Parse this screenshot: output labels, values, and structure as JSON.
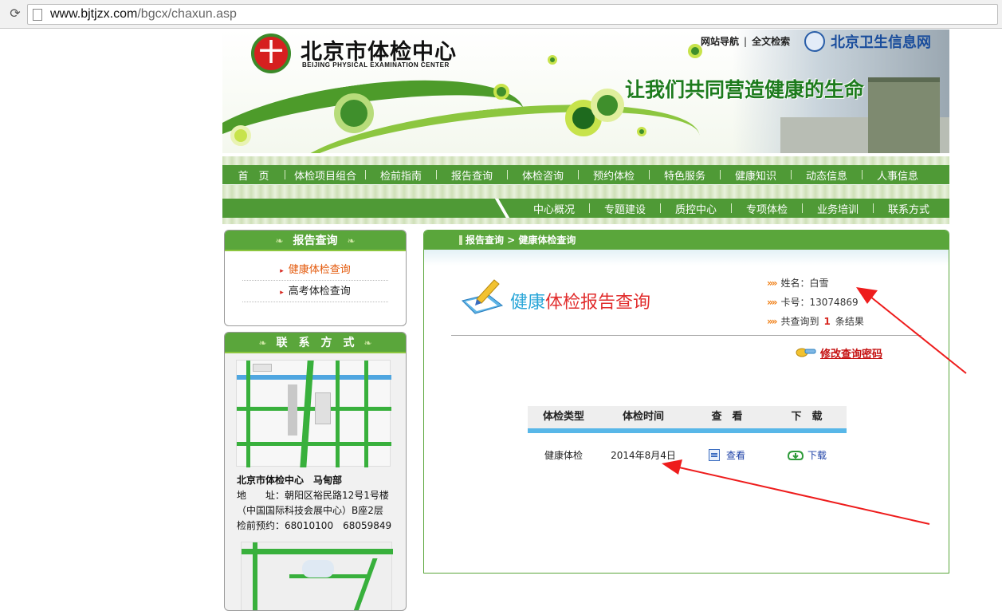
{
  "browser": {
    "url_host": "www.bjtjzx.com",
    "url_path": "/bgcx/chaxun.asp"
  },
  "header": {
    "title_cn": "北京市体检中心",
    "title_en": "BEIJING PHYSICAL EXAMINATION CENTER",
    "slogan": "让我们共同营造健康的生命",
    "link_nav": "网站导航",
    "link_search": "全文检索",
    "partner": "北京卫生信息网"
  },
  "nav_main": [
    "首　页",
    "体检项目组合",
    "检前指南",
    "报告查询",
    "体检咨询",
    "预约体检",
    "特色服务",
    "健康知识",
    "动态信息",
    "人事信息"
  ],
  "nav_sub": [
    "中心概况",
    "专题建设",
    "质控中心",
    "专项体检",
    "业务培训",
    "联系方式"
  ],
  "sidebar": {
    "report_title": "报告查询",
    "report_items": [
      "健康体检查询",
      "高考体检查询"
    ],
    "contact_title": "联　系　方　式",
    "contact_name": "北京市体检中心　马甸部",
    "contact_addr_1": "地　　址：朝阳区裕民路12号1号楼",
    "contact_addr_2": "（中国国际科技会展中心）B座2层",
    "contact_phone": "检前预约：68010100　68059849"
  },
  "content": {
    "breadcrumb": "报告查询 > 健康体检查询",
    "title_blue": "健康",
    "title_red": "体检报告查询",
    "name_label": "姓名：白雪",
    "card_label": "卡号：13074869",
    "result_prefix": "共查询到",
    "result_count": "1",
    "result_suffix": "条结果",
    "change_pwd": "修改查询密码"
  },
  "table": {
    "headers": [
      "体检类型",
      "体检时间",
      "查　看",
      "下　载"
    ],
    "rows": [
      {
        "type": "健康体检",
        "date": "2014年8月4日",
        "view": "查看",
        "download": "下载"
      }
    ]
  },
  "colors": {
    "nav_green": "#4f9a36",
    "header_green": "#5aa63b",
    "accent_orange": "#e45a0c",
    "link_red": "#c51010",
    "table_blue": "#58b7e8",
    "annotation_red": "#ee1c1c"
  }
}
